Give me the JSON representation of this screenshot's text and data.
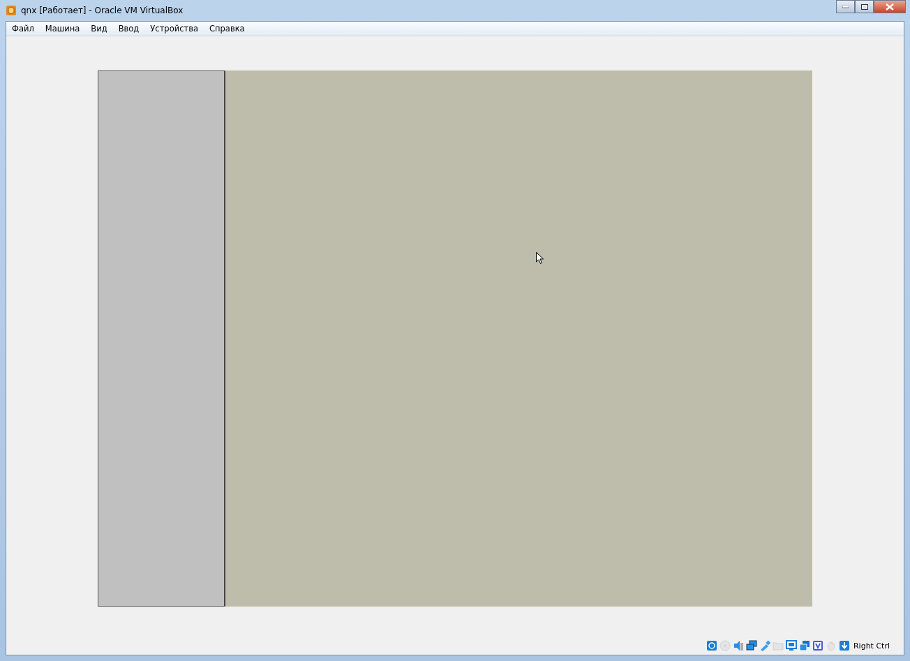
{
  "window": {
    "title": "qnx [Работает] - Oracle VM VirtualBox"
  },
  "menu": [
    {
      "label": "Файл"
    },
    {
      "label": "Машина"
    },
    {
      "label": "Вид"
    },
    {
      "label": "Ввод"
    },
    {
      "label": "Устройства"
    },
    {
      "label": "Справка"
    }
  ],
  "status_bar": {
    "indicators": [
      {
        "kind": "disk",
        "disabled": false
      },
      {
        "kind": "optical",
        "disabled": true
      },
      {
        "kind": "audio",
        "disabled": false
      },
      {
        "kind": "network",
        "disabled": false
      },
      {
        "kind": "usb",
        "disabled": false
      },
      {
        "kind": "folder",
        "disabled": true
      },
      {
        "kind": "display",
        "disabled": false
      },
      {
        "kind": "capture",
        "disabled": false
      },
      {
        "kind": "vtx",
        "disabled": false
      },
      {
        "kind": "mouse",
        "disabled": true
      },
      {
        "kind": "keyboard",
        "disabled": false
      }
    ],
    "host_key": "Right Ctrl"
  }
}
